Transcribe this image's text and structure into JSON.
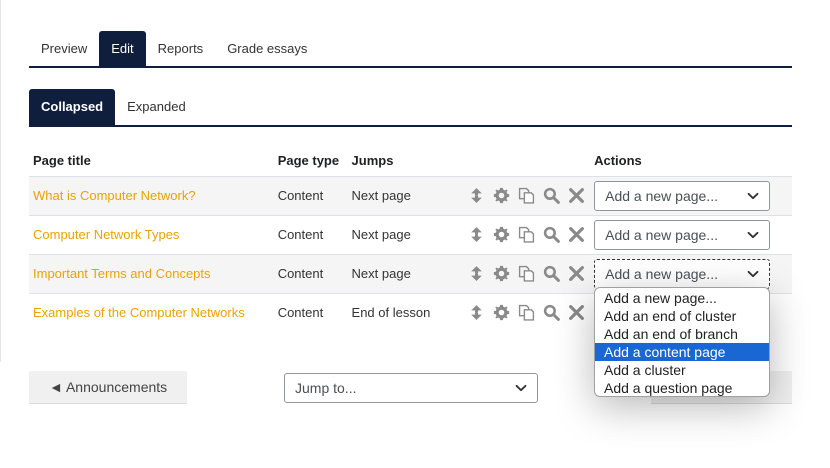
{
  "tabs": [
    {
      "label": "Preview",
      "active": false
    },
    {
      "label": "Edit",
      "active": true
    },
    {
      "label": "Reports",
      "active": false
    },
    {
      "label": "Grade essays",
      "active": false
    }
  ],
  "subtabs": [
    {
      "label": "Collapsed",
      "active": true
    },
    {
      "label": "Expanded",
      "active": false
    }
  ],
  "table": {
    "headers": {
      "title": "Page title",
      "type": "Page type",
      "jumps": "Jumps",
      "actions": "Actions"
    },
    "rows": [
      {
        "title": "What is Computer Network?",
        "type": "Content",
        "jumps": "Next page",
        "select": "Add a new page..."
      },
      {
        "title": "Computer Network Types",
        "type": "Content",
        "jumps": "Next page",
        "select": "Add a new page..."
      },
      {
        "title": "Important Terms and Concepts",
        "type": "Content",
        "jumps": "Next page",
        "select": "Add a new page..."
      },
      {
        "title": "Examples of the Computer Networks",
        "type": "Content",
        "jumps": "End of lesson",
        "select": ""
      }
    ]
  },
  "action_icons": [
    "move-icon",
    "gear-icon",
    "copy-icon",
    "search-icon",
    "delete-icon"
  ],
  "dropdown": {
    "options": [
      "Add a new page...",
      "Add an end of cluster",
      "Add an end of branch",
      "Add a content page",
      "Add a cluster",
      "Add a question page"
    ],
    "highlighted_index": 3
  },
  "nav": {
    "prev_label": "◄ Announcements",
    "jump_placeholder": "Jump to...",
    "next_label": "►"
  },
  "colors": {
    "primary": "#0f1e3d",
    "link": "#e8a400",
    "highlight": "#1967d2",
    "icon": "#8a8a8a"
  }
}
